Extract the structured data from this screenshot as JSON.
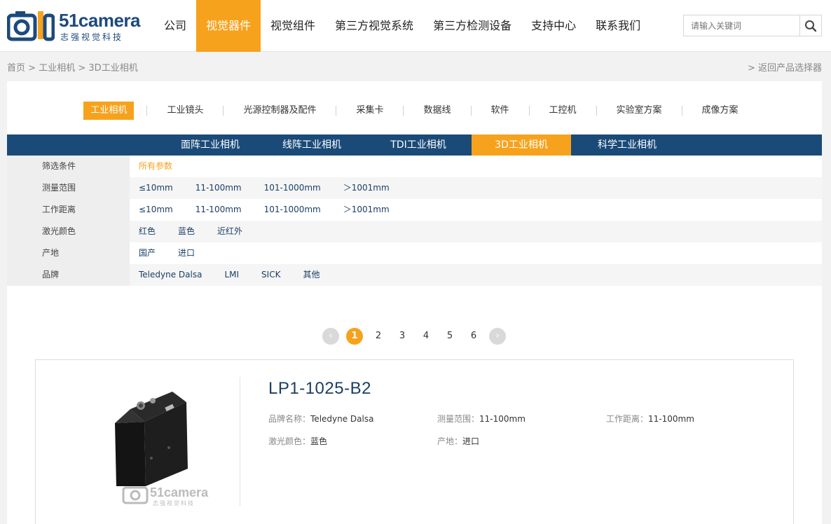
{
  "brand": {
    "logo_text": "51camera",
    "logo_sub": "志强视觉科技",
    "brand_color": "#1c4a7c",
    "accent_color": "#f7a21c"
  },
  "nav": [
    {
      "label": "公司",
      "active": false
    },
    {
      "label": "视觉器件",
      "active": true
    },
    {
      "label": "视觉组件",
      "active": false
    },
    {
      "label": "第三方视觉系统",
      "active": false
    },
    {
      "label": "第三方检测设备",
      "active": false
    },
    {
      "label": "支持中心",
      "active": false
    },
    {
      "label": "联系我们",
      "active": false
    }
  ],
  "search": {
    "placeholder": "请输入关键词",
    "icon": "search-icon"
  },
  "breadcrumb": {
    "home": "首页",
    "sep": ">",
    "level1": "工业相机",
    "level2": "3D工业相机"
  },
  "back_link": "> 返回产品选择器",
  "categories": [
    {
      "label": "工业相机",
      "active": true
    },
    {
      "label": "工业镜头",
      "active": false
    },
    {
      "label": "光源控制器及配件",
      "active": false
    },
    {
      "label": "采集卡",
      "active": false
    },
    {
      "label": "数据线",
      "active": false
    },
    {
      "label": "软件",
      "active": false
    },
    {
      "label": "工控机",
      "active": false
    },
    {
      "label": "实验室方案",
      "active": false
    },
    {
      "label": "成像方案",
      "active": false
    }
  ],
  "subcategories": [
    {
      "label": "面阵工业相机",
      "active": false
    },
    {
      "label": "线阵工业相机",
      "active": false
    },
    {
      "label": "TDI工业相机",
      "active": false
    },
    {
      "label": "3D工业相机",
      "active": true
    },
    {
      "label": "科学工业相机",
      "active": false
    }
  ],
  "filters": [
    {
      "label": "筛选条件",
      "values": [
        "所有参数"
      ],
      "highlight": true
    },
    {
      "label": "测量范围",
      "values": [
        "≤10mm",
        "11-100mm",
        "101-1000mm",
        "＞1001mm"
      ]
    },
    {
      "label": "工作距离",
      "values": [
        "≤10mm",
        "11-100mm",
        "101-1000mm",
        "＞1001mm"
      ]
    },
    {
      "label": "激光颜色",
      "values": [
        "红色",
        "蓝色",
        "近红外"
      ]
    },
    {
      "label": "产地",
      "values": [
        "国产",
        "进口"
      ]
    },
    {
      "label": "品牌",
      "values": [
        "Teledyne Dalsa",
        "LMI",
        "SICK",
        "其他"
      ]
    }
  ],
  "pagination": {
    "prev": "‹",
    "next": "›",
    "pages": [
      "1",
      "2",
      "3",
      "4",
      "5",
      "6"
    ],
    "current": "1"
  },
  "product": {
    "title": "LP1-1025-B2",
    "image_watermark": "51camera",
    "image_watermark_sub": "志强视觉科技",
    "specs": [
      {
        "key": "品牌名称：",
        "value": "Teledyne Dalsa"
      },
      {
        "key": "测量范围：",
        "value": "11-100mm"
      },
      {
        "key": "工作距离：",
        "value": "11-100mm"
      },
      {
        "key": "激光颜色：",
        "value": "蓝色"
      },
      {
        "key": "产地：",
        "value": "进口"
      }
    ]
  }
}
